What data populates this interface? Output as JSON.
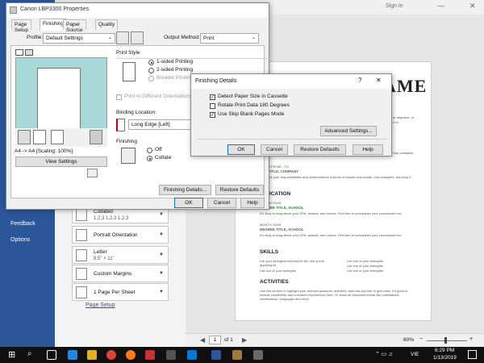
{
  "word": {
    "signin": "Sign in",
    "sidebar": {
      "feedback": "Feedback",
      "options": "Options"
    },
    "print_pane": {
      "cards": [
        {
          "line1": "Collated",
          "line2": "1,2,3    1,2,3    1,2,3"
        },
        {
          "line1": "Portrait Orientation",
          "line2": ""
        },
        {
          "line1": "Letter",
          "line2": "8.5\" × 11\""
        },
        {
          "line1": "Custom Margins",
          "line2": ""
        },
        {
          "line1": "1 Page Per Sheet",
          "line2": ""
        }
      ],
      "page_setup_link": "Page Setup"
    },
    "document": {
      "title_fragment": "AME",
      "frag_objective": "ur objective, or",
      "frag_to": "e to.",
      "frag_examples": "Use examples,",
      "dates_from": "DATES FROM – TO",
      "job_title": "JOB TITLE, COMPANY",
      "job_desc": "Describe your responsibilities and achievements in terms of impact and results. Use examples, but keep it short.",
      "education": "EDUCATION",
      "month_year_1": "MONTH YEAR",
      "degree_1": "DEGREE TITLE, SCHOOL",
      "edu_desc_1": "It's okay to brag about your GPA, awards, and honors. Feel free to summarize your coursework too.",
      "month_year_2": "MONTH YEAR",
      "degree_2": "DEGREE TITLE, SCHOOL",
      "edu_desc_2": "It's okay to brag about your GPA, awards, and honors. Feel free to summarize your coursework too.",
      "skills": "SKILLS",
      "skills_left": [
        "List your strengths relevant for the role you're applying for",
        "List one of your strengths"
      ],
      "skills_right": [
        "List one of your strengths",
        "List one of your strengths",
        "List one of your strengths"
      ],
      "activities": "ACTIVITIES",
      "activities_desc": "Use this section to highlight your relevant passions, activities, and how you like to give back. It's good to include Leadership and volunteer experiences here. Or show off important extras like publications, certifications, languages and more."
    },
    "preview_bottom": {
      "page_current": "1",
      "page_of": "of 1",
      "zoom": "60%"
    }
  },
  "props": {
    "title": "Canon LBP3300 Properties",
    "tabs": [
      "Page Setup",
      "Finishing",
      "Paper Source",
      "Quality"
    ],
    "active_tab": "Finishing",
    "profile_label": "Profile:",
    "profile_value": "Default Settings",
    "output_method_label": "Output Method:",
    "output_method_value": "Print",
    "preview_caption": "A4 -> A4 [Scaling: 100%]",
    "view_settings": "View Settings",
    "print_style_label": "Print Style",
    "print_style_options": [
      "1-sided Printing",
      "2-sided Printing",
      "Booklet Printing"
    ],
    "print_diff_orient": "Print in Different Orientations",
    "binding_location_label": "Binding Location:",
    "binding_location_value": "Long Edge [Left]",
    "finishing_label": "Finishing",
    "finishing_options": [
      "Off",
      "Collate"
    ],
    "finishing_details_btn": "Finishing Details...",
    "restore_defaults_btn": "Restore Defaults",
    "ok": "OK",
    "cancel": "Cancel",
    "help": "Help"
  },
  "finishing_details": {
    "title": "Finishing Details",
    "help_glyph": "?",
    "close_glyph": "✕",
    "options": [
      {
        "label": "Detect Paper Size in Cassette",
        "checked": true
      },
      {
        "label": "Rotate Print Data 180 Degrees",
        "checked": false
      },
      {
        "label": "Use Skip Blank Pages Mode",
        "checked": true
      }
    ],
    "advanced_btn": "Advanced Settings...",
    "ok": "OK",
    "cancel": "Cancel",
    "restore_defaults": "Restore Defaults",
    "help": "Help"
  },
  "taskbar": {
    "time": "6:29 PM",
    "date": "1/13/2019",
    "lang": "VIE"
  },
  "colors": {
    "word_blue": "#2b579a",
    "accent": "#0078d7",
    "resume_green": "#3a7a3a"
  }
}
